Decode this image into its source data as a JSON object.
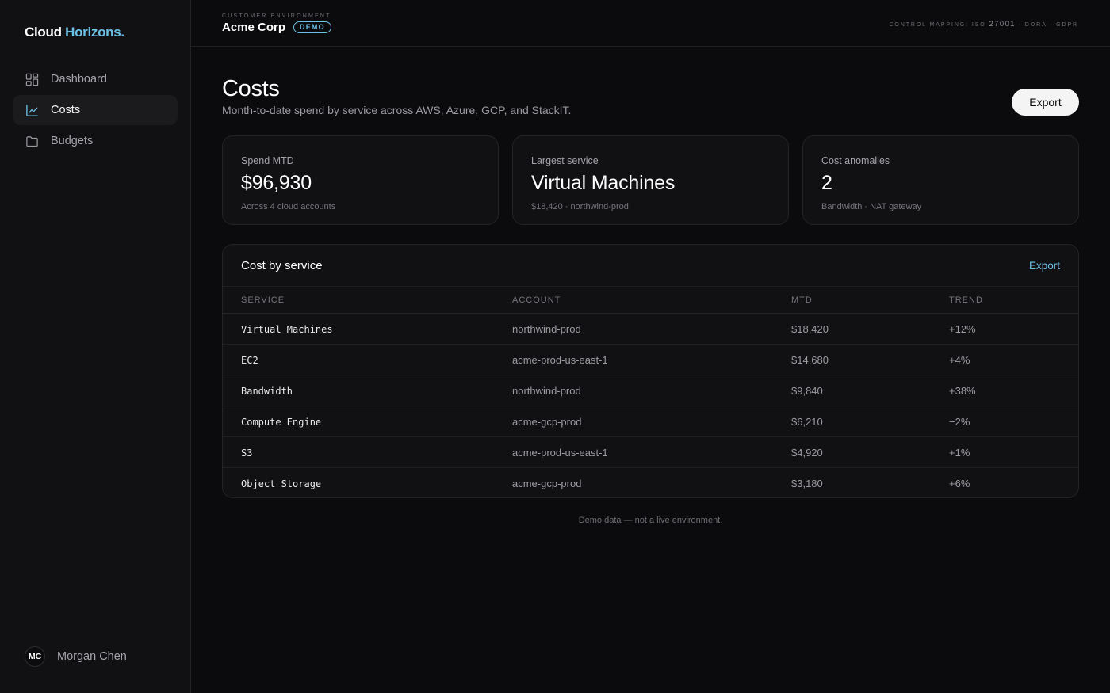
{
  "brand": {
    "name": "Cloud",
    "accent": "Horizons."
  },
  "nav": [
    {
      "label": "Dashboard",
      "icon": "dashboard-grid-icon",
      "active": false
    },
    {
      "label": "Costs",
      "icon": "line-chart-icon",
      "active": true
    },
    {
      "label": "Budgets",
      "icon": "folder-icon",
      "active": false
    }
  ],
  "user": {
    "initials": "MC",
    "name": "Morgan Chen"
  },
  "topbar": {
    "env_caption": "CUSTOMER ENVIRONMENT",
    "env_name": "Acme Corp",
    "badge": "DEMO",
    "control_prefix": "CONTROL MAPPING: ISO",
    "control_num": "27001",
    "control_suffix": "· DORA · GDPR"
  },
  "page": {
    "title": "Costs",
    "subtitle": "Month-to-date spend by service across AWS, Azure, GCP, and StackIT.",
    "export_label": "Export"
  },
  "cards": [
    {
      "label": "Spend MTD",
      "value": "$96,930",
      "sub": "Across 4 cloud accounts"
    },
    {
      "label": "Largest service",
      "value": "Virtual Machines",
      "sub": "$18,420 · northwind-prod"
    },
    {
      "label": "Cost anomalies",
      "value": "2",
      "sub": "Bandwidth · NAT gateway"
    }
  ],
  "table": {
    "title": "Cost by service",
    "export_label": "Export",
    "columns": [
      "SERVICE",
      "ACCOUNT",
      "MTD",
      "TREND"
    ],
    "rows": [
      {
        "service": "Virtual Machines",
        "account": "northwind-prod",
        "mtd": "$18,420",
        "trend": "+12%"
      },
      {
        "service": "EC2",
        "account": "acme-prod-us-east-1",
        "mtd": "$14,680",
        "trend": "+4%"
      },
      {
        "service": "Bandwidth",
        "account": "northwind-prod",
        "mtd": "$9,840",
        "trend": "+38%"
      },
      {
        "service": "Compute Engine",
        "account": "acme-gcp-prod",
        "mtd": "$6,210",
        "trend": "−2%"
      },
      {
        "service": "S3",
        "account": "acme-prod-us-east-1",
        "mtd": "$4,920",
        "trend": "+1%"
      },
      {
        "service": "Object Storage",
        "account": "acme-gcp-prod",
        "mtd": "$3,180",
        "trend": "+6%"
      }
    ]
  },
  "footnote": "Demo data — not a live environment.",
  "colors": {
    "accent": "#6cc0e6",
    "background": "#0b0b0d",
    "surface": "#111113"
  }
}
